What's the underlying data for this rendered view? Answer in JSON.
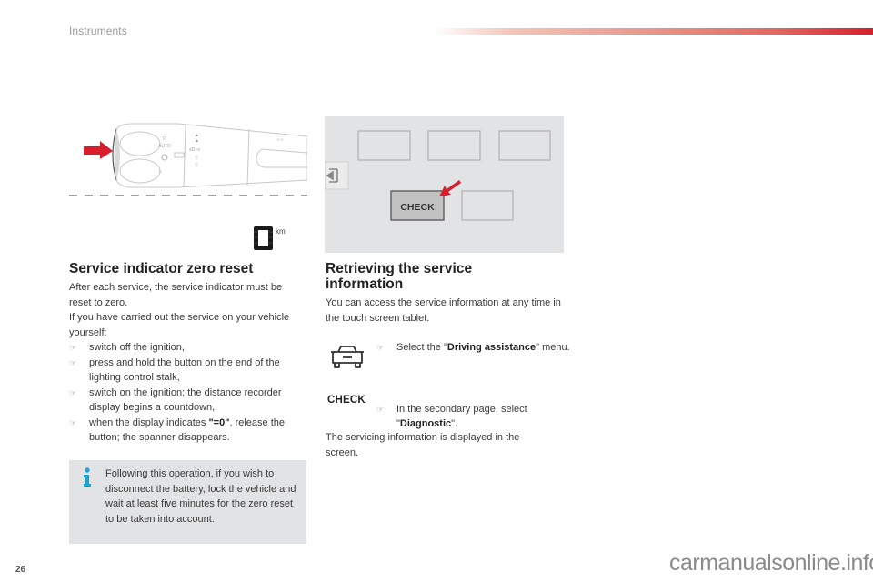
{
  "header": {
    "section_title": "Instruments",
    "accent_color": "#d81e2c"
  },
  "figures": {
    "stalk": {
      "description": "lighting control stalk with reset button at the end",
      "labels": {
        "auto": "AUTO"
      }
    },
    "odometer": {
      "unit_label": "km"
    },
    "touchscreen": {
      "check_button_label": "CHECK"
    }
  },
  "left": {
    "title": "Service indicator zero reset",
    "paragraph1": "After each service, the service indicator must be reset to zero.",
    "paragraph2": "If you have carried out the service on your vehicle yourself:",
    "bullet_icon": "pointing-hand-icon",
    "bullets": [
      {
        "text": "switch off the ignition,"
      },
      {
        "text": "press and hold the button on the end of the lighting control stalk,"
      },
      {
        "text": "switch on the ignition; the distance recorder display begins a countdown,"
      },
      {
        "pre": "when the display indicates ",
        "bold": "\"=0\"",
        "post": ", release the button; the spanner disappears."
      }
    ],
    "note": {
      "icon": "info-icon",
      "icon_color": "#1aa3d9",
      "text": "Following this operation, if you wish to disconnect the battery, lock the vehicle and wait at least five minutes for the zero reset to be taken into account."
    }
  },
  "right": {
    "title": "Retrieving the service information",
    "paragraph1": "You can access the service information at any time in the touch screen tablet.",
    "steps": [
      {
        "icon": "car-icon",
        "pre": "Select the \"",
        "bold": "Driving assistance",
        "post": "\" menu."
      },
      {
        "icon_label": "CHECK",
        "pre": "In the secondary page, select \"",
        "bold": "Diagnostic",
        "post": "\"."
      }
    ],
    "paragraph2": "The servicing information is displayed in the screen."
  },
  "footer": {
    "page_number": "26",
    "watermark": "carmanualsonline.info"
  }
}
